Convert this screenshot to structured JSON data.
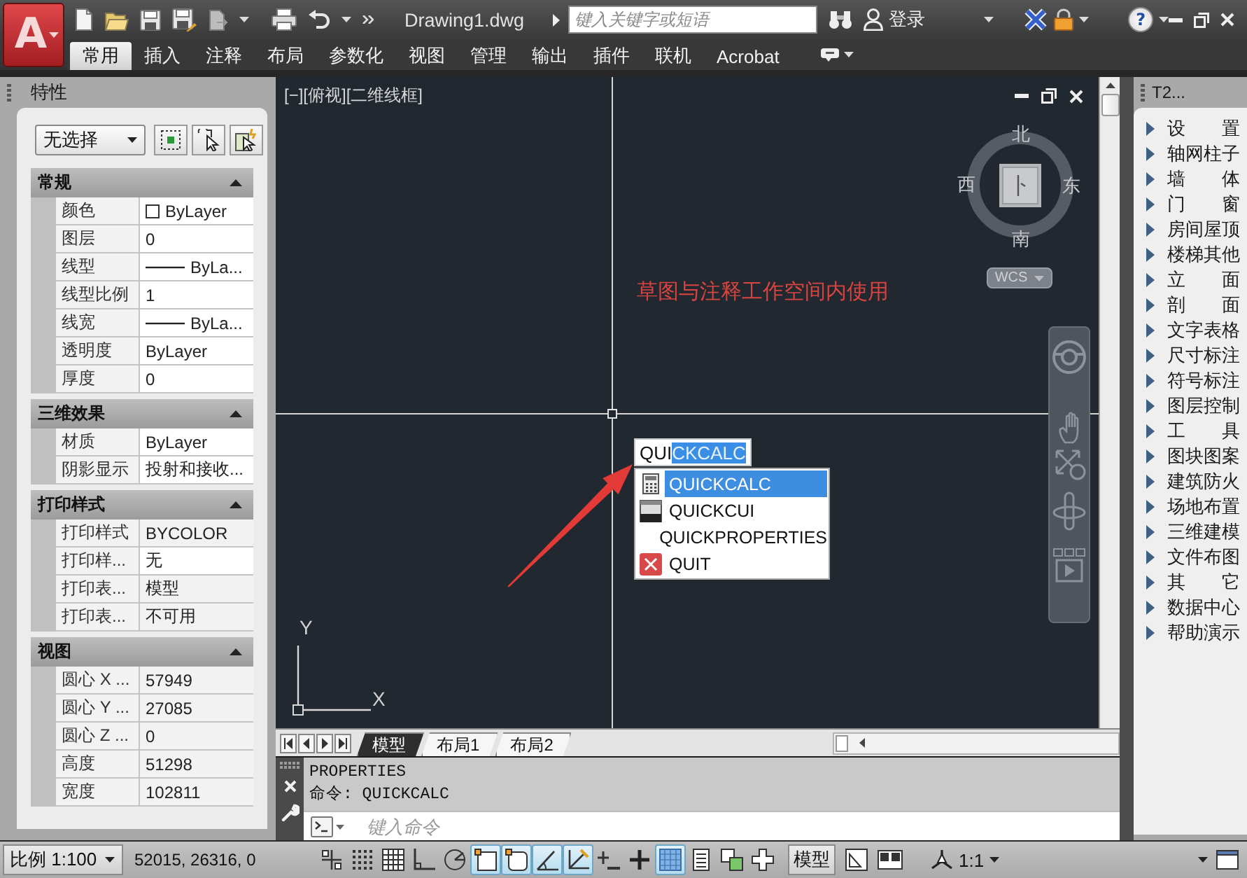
{
  "app_menu": {
    "logo": "A"
  },
  "title_bar": {
    "document": "Drawing1.dwg",
    "search_placeholder": "键入关键字或短语",
    "sign_in": "登录",
    "help": "?"
  },
  "ribbon_tabs": [
    {
      "label": "常用",
      "selected": true
    },
    {
      "label": "插入",
      "selected": false
    },
    {
      "label": "注释",
      "selected": false
    },
    {
      "label": "布局",
      "selected": false
    },
    {
      "label": "参数化",
      "selected": false
    },
    {
      "label": "视图",
      "selected": false
    },
    {
      "label": "管理",
      "selected": false
    },
    {
      "label": "输出",
      "selected": false
    },
    {
      "label": "插件",
      "selected": false
    },
    {
      "label": "联机",
      "selected": false
    },
    {
      "label": "Acrobat",
      "selected": false
    }
  ],
  "properties": {
    "title": "特性",
    "selection": "无选择",
    "sections": [
      {
        "title": "常规",
        "expanded": true,
        "rows": [
          {
            "label": "颜色",
            "value": "ByLayer",
            "kind": "color",
            "editable": true
          },
          {
            "label": "图层",
            "value": "0",
            "kind": "text",
            "editable": true
          },
          {
            "label": "线型",
            "value": "ByLa...",
            "kind": "line",
            "editable": true
          },
          {
            "label": "线型比例",
            "value": "1",
            "kind": "text",
            "editable": true
          },
          {
            "label": "线宽",
            "value": "ByLa...",
            "kind": "line",
            "editable": true
          },
          {
            "label": "透明度",
            "value": "ByLayer",
            "kind": "text",
            "editable": true
          },
          {
            "label": "厚度",
            "value": "0",
            "kind": "text",
            "editable": true
          }
        ]
      },
      {
        "title": "三维效果",
        "expanded": true,
        "rows": [
          {
            "label": "材质",
            "value": "ByLayer",
            "kind": "text",
            "editable": true
          },
          {
            "label": "阴影显示",
            "value": "投射和接收...",
            "kind": "text",
            "editable": true
          }
        ]
      },
      {
        "title": "打印样式",
        "expanded": true,
        "rows": [
          {
            "label": "打印样式",
            "value": "BYCOLOR",
            "kind": "text",
            "editable": false
          },
          {
            "label": "打印样...",
            "value": "无",
            "kind": "text",
            "editable": true
          },
          {
            "label": "打印表...",
            "value": "模型",
            "kind": "text",
            "editable": false
          },
          {
            "label": "打印表...",
            "value": "不可用",
            "kind": "text",
            "editable": false
          }
        ]
      },
      {
        "title": "视图",
        "expanded": true,
        "rows": [
          {
            "label": "圆心 X ...",
            "value": "57949",
            "kind": "text",
            "editable": false
          },
          {
            "label": "圆心 Y ...",
            "value": "27085",
            "kind": "text",
            "editable": false
          },
          {
            "label": "圆心 Z ...",
            "value": "0",
            "kind": "text",
            "editable": false
          },
          {
            "label": "高度",
            "value": "51298",
            "kind": "text",
            "editable": false
          },
          {
            "label": "宽度",
            "value": "102811",
            "kind": "text",
            "editable": false
          }
        ]
      }
    ]
  },
  "drawing": {
    "viewport_label": "[−][俯视][二维线框]",
    "note": "草图与注释工作空间内使用",
    "viewcube": {
      "north": "北",
      "south": "南",
      "west": "西",
      "east": "东",
      "ucs_menu": "WCS"
    },
    "ucs": {
      "x_axis": "X",
      "y_axis": "Y"
    },
    "command_entry": {
      "typed": "QUI",
      "completion": "CKCALC"
    },
    "suggestions": [
      {
        "label": "QUICKCALC",
        "kind": "calculator",
        "selected": true
      },
      {
        "label": "QUICKCUI",
        "kind": "cui",
        "selected": false
      },
      {
        "label": "QUICKPROPERTIES",
        "kind": "none",
        "selected": false
      },
      {
        "label": "QUIT",
        "kind": "quit",
        "selected": false
      }
    ]
  },
  "layout_tabs": [
    {
      "label": "模型",
      "selected": true
    },
    {
      "label": "布局1",
      "selected": false
    },
    {
      "label": "布局2",
      "selected": false
    }
  ],
  "command_line": {
    "history": [
      "PROPERTIES",
      "命令: QUICKCALC"
    ],
    "placeholder": "键入命令"
  },
  "tool_palette": {
    "title": "T2...",
    "items": [
      "设 置",
      "轴网柱子",
      "墙 体",
      "门 窗",
      "房间屋顶",
      "楼梯其他",
      "立 面",
      "剖 面",
      "文字表格",
      "尺寸标注",
      "符号标注",
      "图层控制",
      "工 具",
      "图块图案",
      "建筑防火",
      "场地布置",
      "三维建模",
      "文件布图",
      "其 它",
      "数据中心",
      "帮助演示"
    ]
  },
  "status_bar": {
    "scale": "比例 1:100",
    "coordinates": "52015, 26316, 0",
    "toggles": [
      {
        "kind": "infer",
        "on": false
      },
      {
        "kind": "snap",
        "on": false
      },
      {
        "kind": "grid",
        "on": false
      },
      {
        "kind": "ortho",
        "on": false
      },
      {
        "kind": "polar",
        "on": false
      },
      {
        "kind": "osnap",
        "on": true
      },
      {
        "kind": "osnap3d",
        "on": true
      },
      {
        "kind": "otrack",
        "on": true
      },
      {
        "kind": "ducs",
        "on": true
      },
      {
        "kind": "dyn",
        "on": false
      },
      {
        "kind": "lweight",
        "on": false
      },
      {
        "kind": "transparency",
        "on": true
      },
      {
        "kind": "qp",
        "on": false
      },
      {
        "kind": "sc",
        "on": false
      },
      {
        "kind": "am",
        "on": false
      }
    ],
    "space": "模型",
    "annotation_scale": "1:1"
  }
}
